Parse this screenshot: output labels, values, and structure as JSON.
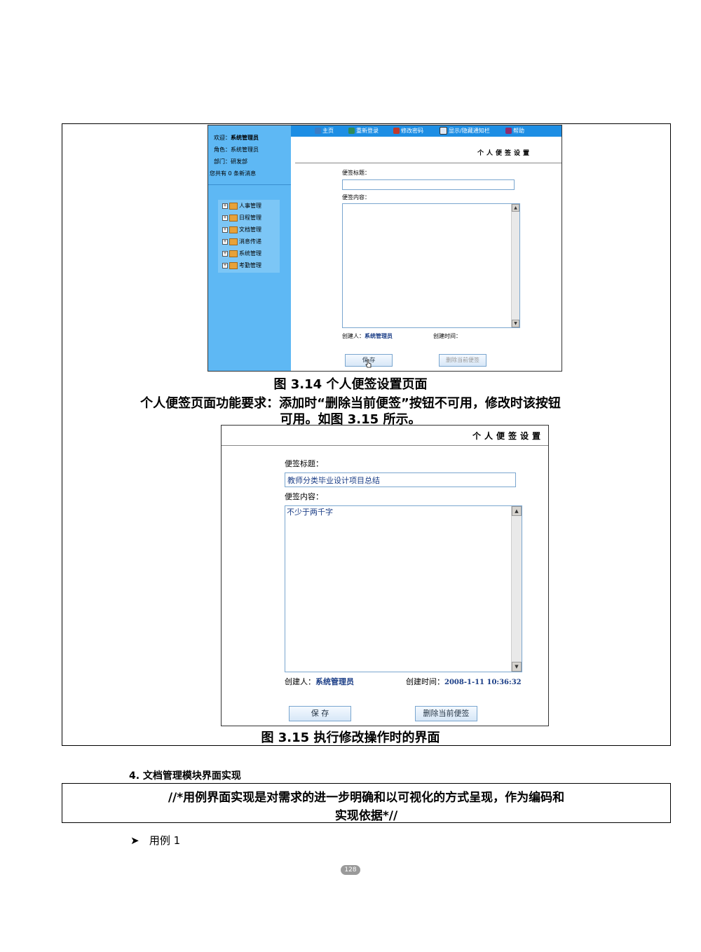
{
  "figure1": {
    "sidebar": {
      "welcome_label": "欢迎：",
      "welcome_user": "系统管理员",
      "role_line": "角色：系统管理员",
      "dept_line": "部门：研发部",
      "messages_line": "您共有 0 条新消息",
      "tree_items": [
        "人事管理",
        "日程管理",
        "文档管理",
        "消息传递",
        "系统管理",
        "考勤管理"
      ]
    },
    "topnav": [
      "主页",
      "重新登录",
      "修改密码",
      "显示/隐藏通知栏",
      "帮助"
    ],
    "page_title": "个人便签设置",
    "title_label": "便签标题：",
    "title_value": "",
    "content_label": "便签内容：",
    "content_value": "",
    "creator_label": "创建人：",
    "creator_value": "系统管理员",
    "created_time_label": "创建时间：",
    "created_time_value": "",
    "save_button": "保 存",
    "delete_button": "删除当前便签",
    "delete_button_enabled": false
  },
  "caption1": "图 3.14 个人便签设置页面",
  "requirement_line1": "个人便签页面功能要求：添加时“删除当前便签”按钮不可用，修改时该按钮",
  "requirement_line2": "可用。如图 3.15 所示。",
  "figure2": {
    "page_title": "个人便签设置",
    "title_label": "便签标题：",
    "title_value": "教师分类毕业设计项目总结",
    "content_label": "便签内容：",
    "content_value": "不少于两千字",
    "creator_label": "创建人：",
    "creator_value": "系统管理员",
    "created_time_label": "创建时间：",
    "created_time_value": "2008-1-11 10:36:32",
    "save_button": "保 存",
    "delete_button": "删除当前便签",
    "delete_button_enabled": true
  },
  "caption2": "图 3.15 执行修改操作时的界面",
  "section_title": "4. 文档管理模块界面实现",
  "note_line1": "//*用例界面实现是对需求的进一步明确和以可视化的方式呈现，作为编码和",
  "note_line2": "实现依据*//",
  "bullet_text": "用例 1",
  "page_number": "128"
}
